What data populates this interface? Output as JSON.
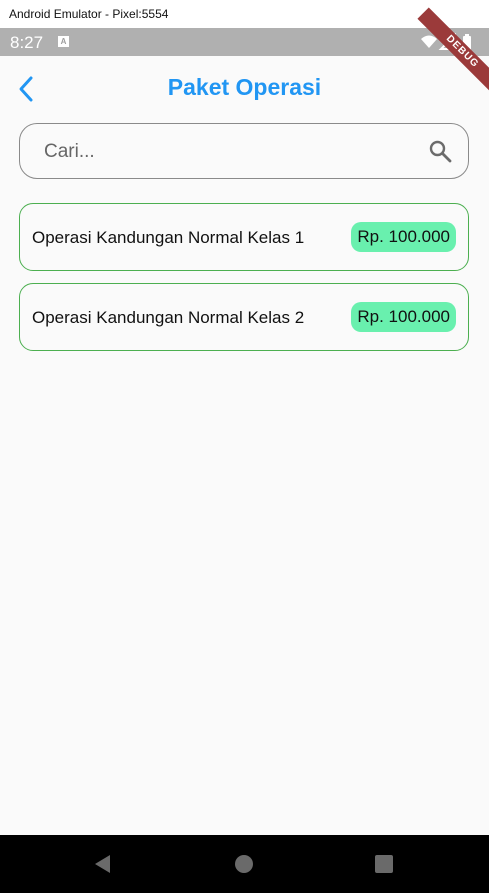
{
  "window": {
    "title": "Android Emulator - Pixel:5554"
  },
  "status_bar": {
    "time": "8:27",
    "notification_badge": "A",
    "icons": [
      "wifi-icon",
      "signal-icon",
      "battery-icon"
    ]
  },
  "debug_banner": "DEBUG",
  "header": {
    "title": "Paket Operasi",
    "back_icon": "chevron-left-icon"
  },
  "search": {
    "placeholder": "Cari...",
    "value": "",
    "icon": "search-icon"
  },
  "packages": [
    {
      "name": "Operasi Kandungan Normal Kelas 1",
      "price": "Rp. 100.000"
    },
    {
      "name": "Operasi Kandungan Normal Kelas 2",
      "price": "Rp. 100.000"
    }
  ],
  "nav_bar": {
    "buttons": [
      "back-triangle-icon",
      "home-circle-icon",
      "recents-square-icon"
    ]
  },
  "colors": {
    "accent": "#2196f3",
    "card_border": "#4caf50",
    "price_badge": "#69f0ae",
    "status_bar": "#b0b0b0",
    "debug_banner": "#9b3a3a"
  }
}
